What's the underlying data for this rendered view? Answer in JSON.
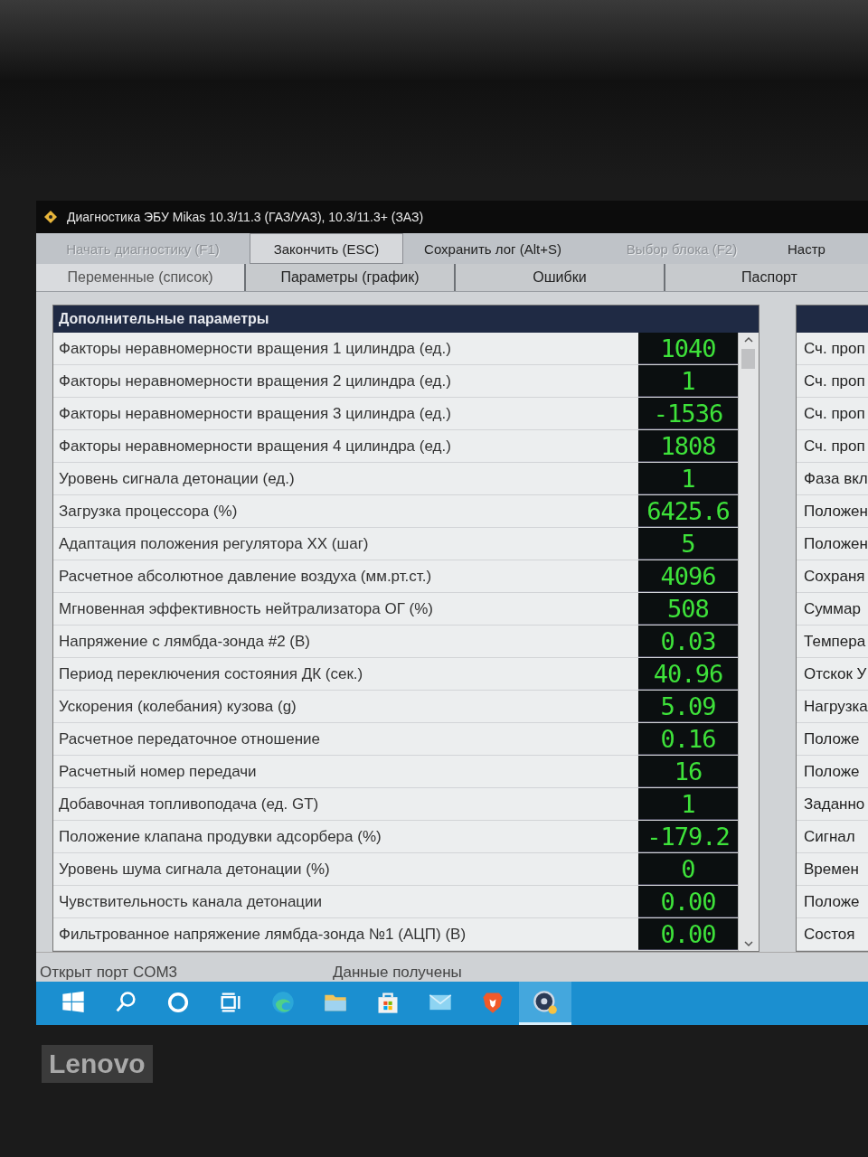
{
  "window": {
    "title": "Диагностика ЭБУ Mikas 10.3/11.3 (ГАЗ/УАЗ), 10.3/11.3+ (ЗАЗ)"
  },
  "toolbar": [
    {
      "label": "Начать диагностику (F1)",
      "disabled": true,
      "pressed": false
    },
    {
      "label": "Закончить (ESC)",
      "disabled": false,
      "pressed": true
    },
    {
      "label": "Сохранить лог (Alt+S)",
      "disabled": false,
      "pressed": false
    },
    {
      "label": "Выбор блока (F2)",
      "disabled": true,
      "pressed": false
    },
    {
      "label": "Настр",
      "disabled": false,
      "pressed": false
    }
  ],
  "tabs": [
    {
      "label": "Переменные (список)",
      "selected": true
    },
    {
      "label": "Параметры (график)",
      "selected": false
    },
    {
      "label": "Ошибки",
      "selected": false
    },
    {
      "label": "Паспорт",
      "selected": false
    }
  ],
  "panel": {
    "title": "Дополнительные параметры",
    "rows": [
      {
        "name": "Факторы неравномерности вращения 1 цилиндра (ед.)",
        "value": "1040"
      },
      {
        "name": "Факторы неравномерности вращения 2 цилиндра (ед.)",
        "value": "1"
      },
      {
        "name": "Факторы неравномерности вращения 3 цилиндра (ед.)",
        "value": "-1536"
      },
      {
        "name": "Факторы неравномерности вращения 4 цилиндра (ед.)",
        "value": "1808"
      },
      {
        "name": "Уровень сигнала детонации (ед.)",
        "value": "1"
      },
      {
        "name": "Загрузка процессора (%)",
        "value": "6425.6"
      },
      {
        "name": "Адаптация положения регулятора ХХ (шаг)",
        "value": "5"
      },
      {
        "name": "Расчетное абсолютное давление воздуха (мм.рт.ст.)",
        "value": "4096"
      },
      {
        "name": "Мгновенная эффективность нейтрализатора ОГ (%)",
        "value": "508"
      },
      {
        "name": "Напряжение с лямбда-зонда #2 (В)",
        "value": "0.03"
      },
      {
        "name": "Период переключения состояния ДК (сек.)",
        "value": "40.96"
      },
      {
        "name": "Ускорения (колебания) кузова (g)",
        "value": "5.09"
      },
      {
        "name": "Расчетное передаточное отношение",
        "value": "0.16"
      },
      {
        "name": "Расчетный номер передачи",
        "value": "16"
      },
      {
        "name": "Добавочная топливоподача (ед. GT)",
        "value": "1"
      },
      {
        "name": "Положение клапана продувки адсорбера (%)",
        "value": "-179.2"
      },
      {
        "name": "Уровень шума сигнала детонации (%)",
        "value": "0"
      },
      {
        "name": "Чувствительность канала детонации",
        "value": "0.00"
      },
      {
        "name": "Фильтрованное напряжение лямбда-зонда №1 (АЦП) (В)",
        "value": "0.00"
      }
    ]
  },
  "side_panel": {
    "rows": [
      "Сч. проп",
      "Сч. проп",
      "Сч. проп",
      "Сч. проп",
      "Фаза вкл",
      "Положен",
      "Положен",
      "Сохраня",
      "Суммар",
      "Темпера",
      "Отскок У",
      "Нагрузка",
      "Положе",
      "Положе",
      "Заданно",
      "Сигнал",
      "Времен",
      "Положе",
      "Состоя"
    ]
  },
  "status_bar": [
    "Открыт порт COM3",
    "Данные получены"
  ],
  "taskbar": [
    {
      "kind": "start"
    },
    {
      "kind": "search"
    },
    {
      "kind": "cortana"
    },
    {
      "kind": "taskview"
    },
    {
      "kind": "edge"
    },
    {
      "kind": "folder"
    },
    {
      "kind": "store"
    },
    {
      "kind": "mail"
    },
    {
      "kind": "brave"
    },
    {
      "kind": "app",
      "selected": true
    }
  ],
  "bezel": {
    "brand": "Lenovo"
  }
}
